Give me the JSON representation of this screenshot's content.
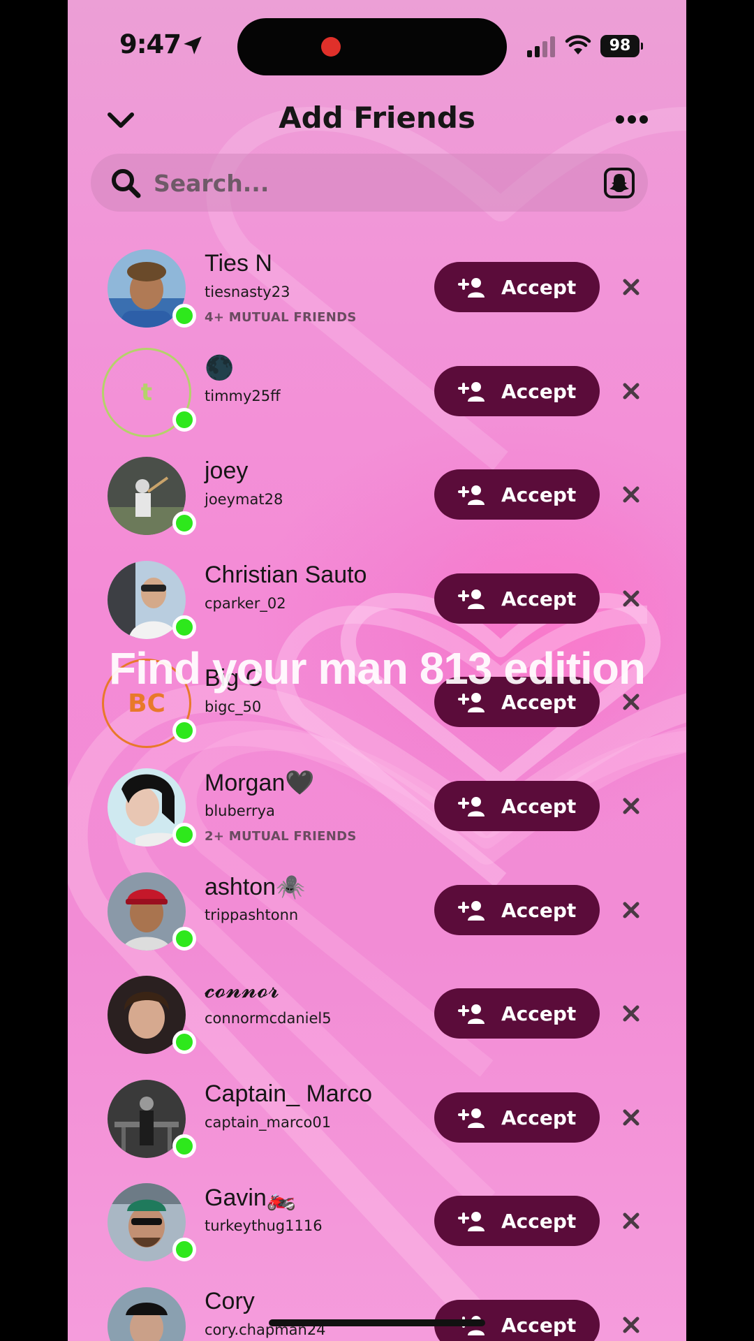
{
  "status": {
    "time": "9:47",
    "battery": "98"
  },
  "header": {
    "title": "Add Friends"
  },
  "search": {
    "placeholder": "Search..."
  },
  "accept_label": "Accept",
  "caption": "Find your man 813 edition",
  "requests": [
    {
      "name": "Ties N",
      "username": "tiesnasty23",
      "mutual": "4+ MUTUAL FRIENDS"
    },
    {
      "name": "🌑",
      "username": "timmy25ff",
      "mutual": "",
      "initials": "t",
      "ring_color": "#b4d26a"
    },
    {
      "name": "joey",
      "username": "joeymat28",
      "mutual": ""
    },
    {
      "name": "Christian Sauto",
      "username": "cparker_02",
      "mutual": ""
    },
    {
      "name": "Big C",
      "username": "bigc_50",
      "mutual": "",
      "initials": "BC",
      "ring_color": "#e8792a"
    },
    {
      "name": "Morgan🖤",
      "username": "bluberrya",
      "mutual": "2+ MUTUAL FRIENDS"
    },
    {
      "name": "ashton🕷️",
      "username": "trippashtonn",
      "mutual": ""
    },
    {
      "name": "𝓬𝓸𝓷𝓷𝓸𝓻",
      "username": "connormcdaniel5",
      "mutual": ""
    },
    {
      "name": "Captain_ Marco",
      "username": "captain_marco01",
      "mutual": ""
    },
    {
      "name": "Gavin🏍️",
      "username": "turkeythug1116",
      "mutual": ""
    },
    {
      "name": "Cory",
      "username": "cory.chapman24",
      "mutual": ""
    }
  ]
}
